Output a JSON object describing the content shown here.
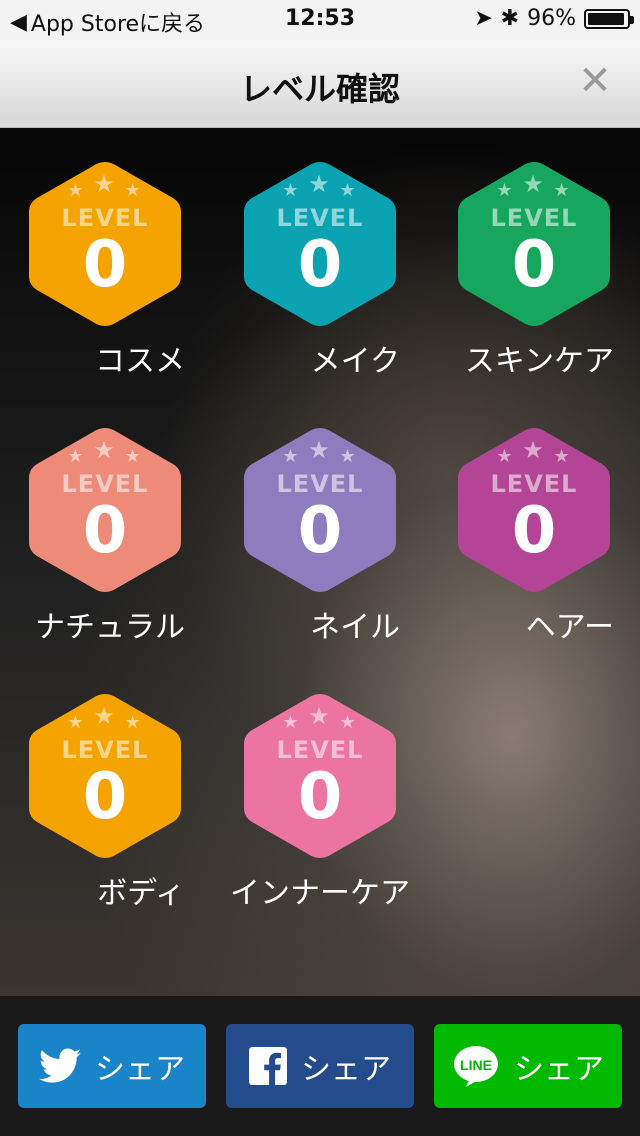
{
  "status_bar": {
    "back_label": "App Storeに戻る",
    "time": "12:53",
    "battery": "96%",
    "battery_level": 0.96
  },
  "nav": {
    "title": "レベル確認",
    "close_icon": "close-icon"
  },
  "level_label": "LEVEL",
  "categories": [
    {
      "name": "コスメ",
      "level": "0",
      "color": "#F5A300"
    },
    {
      "name": "メイク",
      "level": "0",
      "color": "#0BA3B2"
    },
    {
      "name": "スキンケア",
      "level": "0",
      "color": "#16A65D"
    },
    {
      "name": "ナチュラル",
      "level": "0",
      "color": "#EE8A78"
    },
    {
      "name": "ネイル",
      "level": "0",
      "color": "#8E7DBE"
    },
    {
      "name": "ヘアー",
      "level": "0",
      "color": "#B44495"
    },
    {
      "name": "ボディ",
      "level": "0",
      "color": "#F5A300"
    },
    {
      "name": "インナーケア",
      "level": "0",
      "color": "#EC74A0"
    }
  ],
  "share": {
    "twitter": {
      "label": "シェア",
      "icon": "twitter-bird-icon",
      "color": "#1A84C8"
    },
    "facebook": {
      "label": "シェア",
      "icon": "facebook-icon",
      "color": "#244C8C"
    },
    "line": {
      "label": "シェア",
      "icon": "line-icon",
      "icon_text": "LINE",
      "color": "#00B900"
    }
  }
}
